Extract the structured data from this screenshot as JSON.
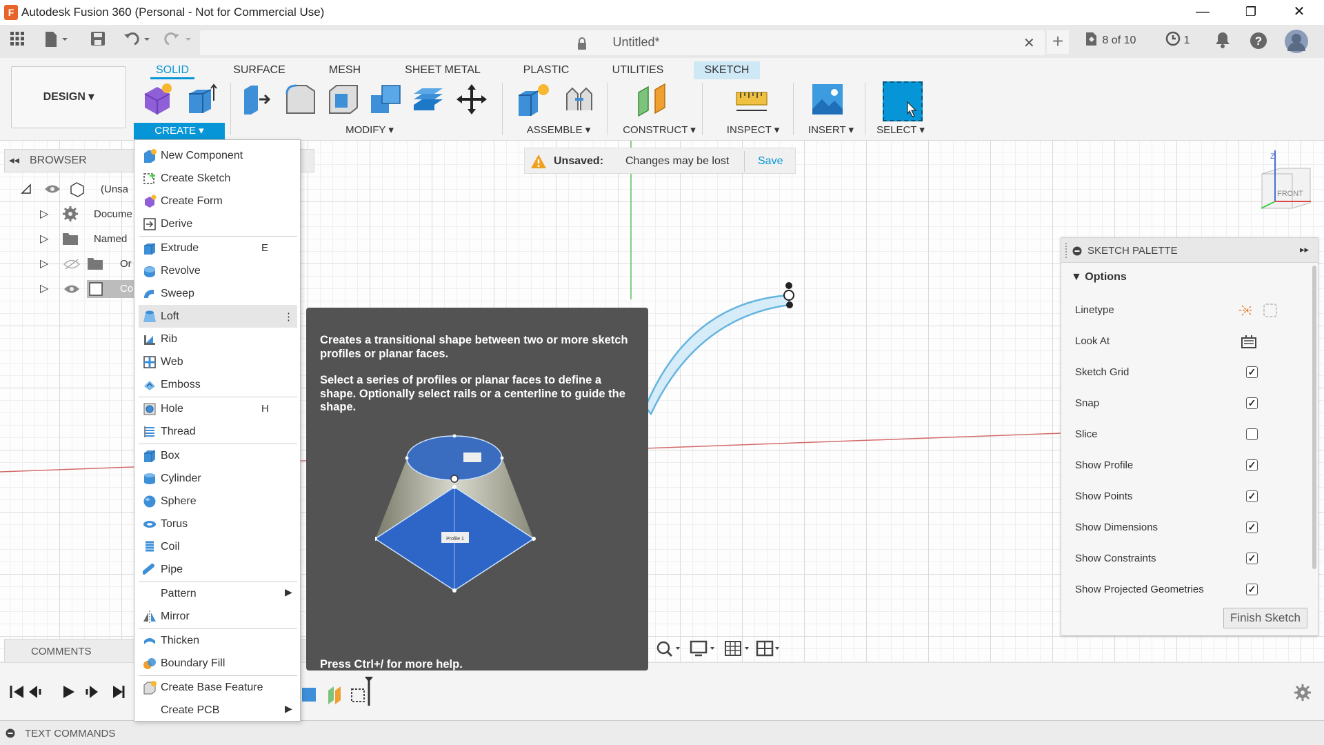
{
  "app": {
    "title": "Autodesk Fusion 360 (Personal - Not for Commercial Use)",
    "icon_letter": "F"
  },
  "window": {
    "minimize": "—",
    "restore": "❐",
    "close": "✕"
  },
  "doc": {
    "name": "Untitled*",
    "close": "✕",
    "jobs": "8 of 10",
    "recovery_count": "1"
  },
  "workspace": {
    "label": "DESIGN ▾"
  },
  "tabs": [
    "SOLID",
    "SURFACE",
    "MESH",
    "SHEET METAL",
    "PLASTIC",
    "UTILITIES",
    "SKETCH"
  ],
  "groups": {
    "create": "CREATE ▾",
    "modify": "MODIFY ▾",
    "assemble": "ASSEMBLE ▾",
    "construct": "CONSTRUCT ▾",
    "inspect": "INSPECT ▾",
    "insert": "INSERT ▾",
    "select": "SELECT ▾"
  },
  "browser": {
    "label": "BROWSER",
    "rows": [
      "(Unsa",
      "Docume",
      "Named",
      "Or",
      "Co"
    ]
  },
  "unsaved": {
    "label": "Unsaved:",
    "message": "Changes may be lost",
    "save": "Save"
  },
  "viewcube": {
    "face": "FRONT",
    "axis": "Z"
  },
  "comments": {
    "label": "COMMENTS"
  },
  "text_commands": {
    "label": "TEXT COMMANDS"
  },
  "menu": {
    "items": [
      {
        "label": "New Component",
        "shortcut": "",
        "icon": "new-component-icon"
      },
      {
        "label": "Create Sketch",
        "shortcut": "",
        "icon": "create-sketch-icon"
      },
      {
        "label": "Create Form",
        "shortcut": "",
        "icon": "create-form-icon"
      },
      {
        "label": "Derive",
        "shortcut": "",
        "icon": "derive-icon"
      },
      {
        "label": "Extrude",
        "shortcut": "E",
        "icon": "extrude-icon"
      },
      {
        "label": "Revolve",
        "shortcut": "",
        "icon": "revolve-icon"
      },
      {
        "label": "Sweep",
        "shortcut": "",
        "icon": "sweep-icon"
      },
      {
        "label": "Loft",
        "shortcut": "⋮",
        "icon": "loft-icon"
      },
      {
        "label": "Rib",
        "shortcut": "",
        "icon": "rib-icon"
      },
      {
        "label": "Web",
        "shortcut": "",
        "icon": "web-icon"
      },
      {
        "label": "Emboss",
        "shortcut": "",
        "icon": "emboss-icon"
      },
      {
        "label": "Hole",
        "shortcut": "H",
        "icon": "hole-icon"
      },
      {
        "label": "Thread",
        "shortcut": "",
        "icon": "thread-icon"
      },
      {
        "label": "Box",
        "shortcut": "",
        "icon": "box-icon"
      },
      {
        "label": "Cylinder",
        "shortcut": "",
        "icon": "cylinder-icon"
      },
      {
        "label": "Sphere",
        "shortcut": "",
        "icon": "sphere-icon"
      },
      {
        "label": "Torus",
        "shortcut": "",
        "icon": "torus-icon"
      },
      {
        "label": "Coil",
        "shortcut": "",
        "icon": "coil-icon"
      },
      {
        "label": "Pipe",
        "shortcut": "",
        "icon": "pipe-icon"
      },
      {
        "label": "Pattern",
        "shortcut": "",
        "icon": "",
        "submenu": true
      },
      {
        "label": "Mirror",
        "shortcut": "",
        "icon": "mirror-icon"
      },
      {
        "label": "Thicken",
        "shortcut": "",
        "icon": "thicken-icon"
      },
      {
        "label": "Boundary Fill",
        "shortcut": "",
        "icon": "boundary-fill-icon"
      },
      {
        "label": "Create Base Feature",
        "shortcut": "",
        "icon": "base-feature-icon"
      },
      {
        "label": "Create PCB",
        "shortcut": "",
        "icon": "",
        "submenu": true
      }
    ]
  },
  "tooltip": {
    "p1": "Creates a transitional shape between two or more sketch profiles or planar faces.",
    "p2": "Select a series of profiles or planar faces to define a shape. Optionally select rails or a centerline to guide the shape.",
    "help": "Press Ctrl+/ for more help.",
    "profile_label": "Profile 1"
  },
  "palette": {
    "title": "SKETCH PALETTE",
    "section": "Options",
    "rows": [
      {
        "label": "Linetype",
        "type": "icons"
      },
      {
        "label": "Look At",
        "type": "button"
      },
      {
        "label": "Sketch Grid",
        "checked": true
      },
      {
        "label": "Snap",
        "checked": true
      },
      {
        "label": "Slice",
        "checked": false
      },
      {
        "label": "Show Profile",
        "checked": true
      },
      {
        "label": "Show Points",
        "checked": true
      },
      {
        "label": "Show Dimensions",
        "checked": true
      },
      {
        "label": "Show Constraints",
        "checked": true
      },
      {
        "label": "Show Projected Geometries",
        "checked": true
      }
    ],
    "finish": "Finish Sketch"
  },
  "colors": {
    "accent": "#0696d7",
    "menu_highlight": "#e6e6e6",
    "tooltip_bg": "#535353"
  }
}
